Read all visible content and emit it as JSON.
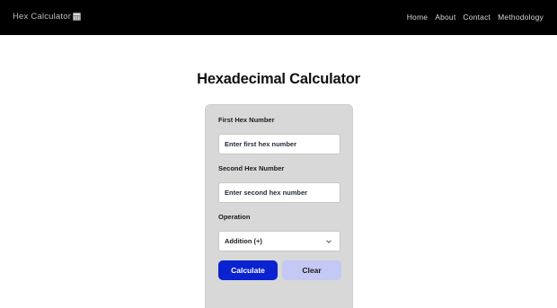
{
  "nav": {
    "brand": "Hex Calculator",
    "brand_icon": "calculator-icon",
    "links": [
      "Home",
      "About",
      "Contact",
      "Methodology"
    ]
  },
  "main": {
    "title": "Hexadecimal Calculator"
  },
  "form": {
    "first_label": "First Hex Number",
    "first_value": "",
    "first_placeholder": "Enter first hex number",
    "second_label": "Second Hex Number",
    "second_value": "",
    "second_placeholder": "Enter second hex number",
    "operation_label": "Operation",
    "operation_selected": "Addition (+)",
    "calculate_label": "Calculate",
    "clear_label": "Clear"
  },
  "colors": {
    "navbar": "#000000",
    "card": "#d8d8d8",
    "calculate_button": "#0a22d0",
    "clear_button": "#c3c8f4"
  }
}
